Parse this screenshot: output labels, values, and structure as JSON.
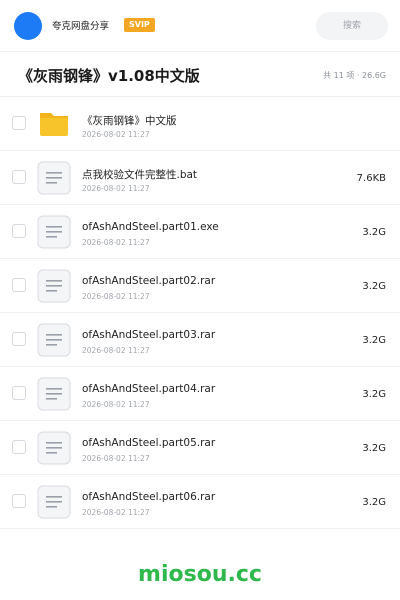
{
  "topbar": {
    "brand": "夸克网盘分享",
    "badge": "SVIP",
    "search_label": "搜索"
  },
  "header": {
    "title": "《灰雨钢锋》v1.08中文版",
    "summary": "共 11 项 · 26.6G"
  },
  "items": [
    {
      "type": "folder",
      "name": "《灰雨钢锋》中文版",
      "date": "2026-08-02 11:27",
      "size": ""
    },
    {
      "type": "file",
      "name": "点我校验文件完整性.bat",
      "date": "2026-08-02 11:27",
      "size": "7.6KB"
    },
    {
      "type": "file",
      "name": "ofAshAndSteel.part01.exe",
      "date": "2026-08-02 11:27",
      "size": "3.2G"
    },
    {
      "type": "file",
      "name": "ofAshAndSteel.part02.rar",
      "date": "2026-08-02 11:27",
      "size": "3.2G"
    },
    {
      "type": "file",
      "name": "ofAshAndSteel.part03.rar",
      "date": "2026-08-02 11:27",
      "size": "3.2G"
    },
    {
      "type": "file",
      "name": "ofAshAndSteel.part04.rar",
      "date": "2026-08-02 11:27",
      "size": "3.2G"
    },
    {
      "type": "file",
      "name": "ofAshAndSteel.part05.rar",
      "date": "2026-08-02 11:27",
      "size": "3.2G"
    },
    {
      "type": "file",
      "name": "ofAshAndSteel.part06.rar",
      "date": "2026-08-02 11:27",
      "size": "3.2G"
    }
  ],
  "watermark": "miosou.cc",
  "colors": {
    "accent": "#1d7bf5",
    "svip": "#f5a623",
    "folder": "#f7c52b",
    "watermark": "#2fb84c"
  }
}
